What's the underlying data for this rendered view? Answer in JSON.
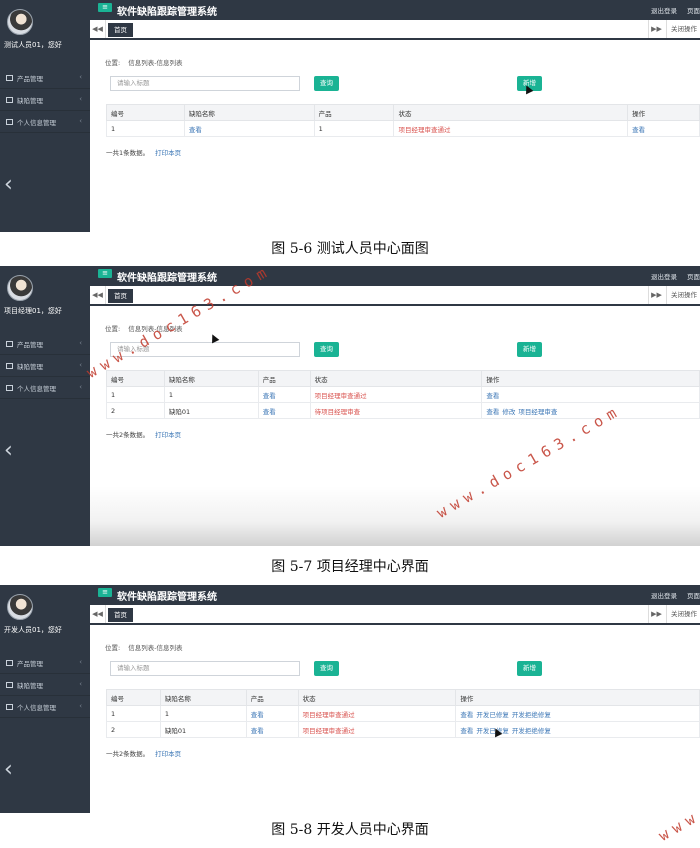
{
  "system_title": "软件缺陷跟踪管理系统",
  "top_actions": {
    "logout": "退出登录",
    "page": "页面"
  },
  "tabs": {
    "home": "首页",
    "close_ops": "关闭操作",
    "prev": "◀◀",
    "next": "▶▶"
  },
  "menu": [
    "产品管理",
    "缺陷管理",
    "个人信息管理"
  ],
  "breadcrumb": {
    "label": "位置:",
    "path": "信息列表-信息列表"
  },
  "search": {
    "placeholder": "请输入标题",
    "button": "查询"
  },
  "add_button": "新增",
  "print_link": "打印本页",
  "columns": [
    "编号",
    "缺陷名称",
    "产品",
    "状态",
    "操作"
  ],
  "panels": [
    {
      "user": "测试人员01，您好",
      "rows": [
        {
          "id": "1",
          "name": "查看",
          "product": "1",
          "status": "项目经理审查通过",
          "actions": [
            "查看"
          ]
        }
      ],
      "summary": "一共1条数据。",
      "caption": "图 5-6 测试人员中心面图"
    },
    {
      "user": "项目经理01，您好",
      "rows": [
        {
          "id": "1",
          "name": "1",
          "product": "查看",
          "status": "项目经理审查通过",
          "actions": [
            "查看"
          ]
        },
        {
          "id": "2",
          "name": "缺陷01",
          "product": "查看",
          "status": "待项目经理审查",
          "actions": [
            "查看",
            "修改",
            "项目经理审查"
          ]
        }
      ],
      "summary": "一共2条数据。",
      "caption": "图 5-7 项目经理中心界面"
    },
    {
      "user": "开发人员01，您好",
      "rows": [
        {
          "id": "1",
          "name": "1",
          "product": "查看",
          "status": "项目经理审查通过",
          "actions": [
            "查看",
            "开发已修复",
            "开发拒绝修复"
          ]
        },
        {
          "id": "2",
          "name": "缺陷01",
          "product": "查看",
          "status": "项目经理审查通过",
          "actions": [
            "查看",
            "开发已修复",
            "开发拒绝修复"
          ]
        }
      ],
      "summary": "一共2条数据。",
      "caption": "图 5-8 开发人员中心界面"
    }
  ],
  "watermark": "www.doc163.com",
  "colors": {
    "sidebar": "#2f3844",
    "accent": "#1ab394",
    "link": "#3c77b6",
    "status": "#d9534f",
    "watermark": "#c0392b"
  }
}
